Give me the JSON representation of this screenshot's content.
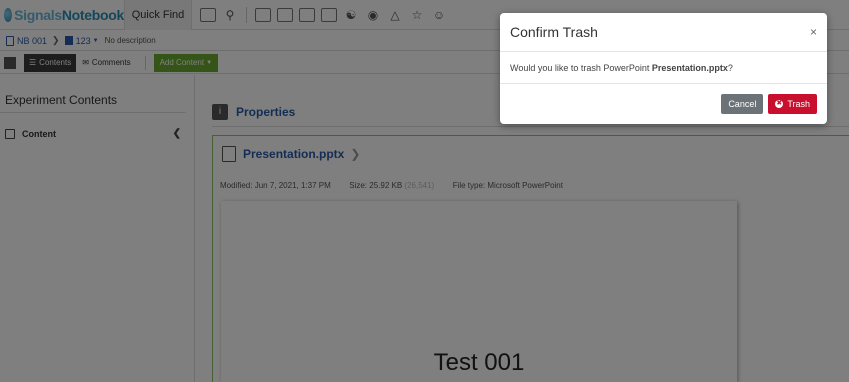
{
  "app": {
    "logo_prefix": "Signals",
    "logo_suffix": "Notebook",
    "quick_find": "Quick Find"
  },
  "breadcrumb": {
    "notebook": "NB 001",
    "experiment": "123",
    "description": "No description"
  },
  "toolbar": {
    "contents_label": "Contents",
    "comments_label": "Comments",
    "add_content_label": "Add Content"
  },
  "sidebar": {
    "title": "Experiment Contents",
    "items": [
      {
        "label": "Content"
      }
    ]
  },
  "main": {
    "properties_label": "Properties",
    "file": {
      "name": "Presentation.pptx",
      "modified_label": "Modified:",
      "modified_value": "Jun 7, 2021, 1:37 PM",
      "size_label": "Size:",
      "size_value": "25.92 KB",
      "size_bytes": "(26,541)",
      "type_label": "File type:",
      "type_value": "Microsoft PowerPoint"
    },
    "preview_title": "Test 001"
  },
  "modal": {
    "title": "Confirm Trash",
    "close_glyph": "×",
    "message_prefix": "Would you like to trash PowerPoint ",
    "message_filename": "Presentation.pptx",
    "message_suffix": "?",
    "cancel_label": "Cancel",
    "trash_label": "Trash"
  },
  "colors": {
    "brand": "#2a8fb8",
    "link": "#2a5aa8",
    "add_button": "#6aa82f",
    "trash_button": "#c8102e",
    "cancel_button": "#6b7278"
  }
}
